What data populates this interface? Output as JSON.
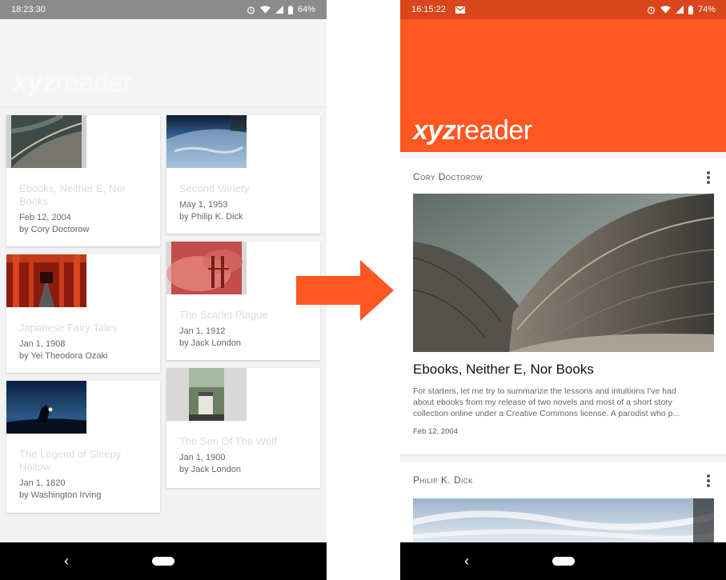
{
  "left": {
    "status": {
      "time": "18:23:30",
      "battery": "64%"
    },
    "app_logo": {
      "bold": "xyz",
      "rest": "reader"
    },
    "articles": [
      {
        "title": "Ebooks, Neither E, Nor Books",
        "date": "Feb 12, 2004",
        "author": "by Cory Doctorow",
        "image": "concrete-roof-photo"
      },
      {
        "title": "Second Variety",
        "date": "May 1, 1953",
        "author": "by Philip K. Dick",
        "image": "earth-from-space-photo"
      },
      {
        "title": "Japanese Fairy Tales",
        "date": "Jan 1, 1908",
        "author": "by Yei Theodora Ozaki",
        "image": "torii-gates-photo"
      },
      {
        "title": "The Scarlet Plague",
        "date": "Jan 1, 1912",
        "author": "by Jack London",
        "image": "bridge-in-red-fog-photo"
      },
      {
        "title": "The Legend of Sleepy Hollow",
        "date": "Jan 1, 1820",
        "author": "by Washington Irving",
        "image": "person-at-night-photo"
      },
      {
        "title": "The Son Of The Wolf",
        "date": "Jan 1, 1900",
        "author": "by Jack London",
        "image": "jar-on-table-photo"
      }
    ]
  },
  "right": {
    "status": {
      "time": "16:15:22",
      "battery": "74%"
    },
    "app_logo": {
      "bold": "xyz",
      "rest": "reader"
    },
    "featured": {
      "author": "Cory Doctorow",
      "title": "Ebooks, Neither E, Nor Books",
      "body_lines": [
        "For starters, let me try to summarize the lessons and intuitions I've had",
        "about ebooks from my release of two novels and most of a short story",
        "collection online under a Creative Commons license. A parodist who p..."
      ],
      "date": "Feb 12, 2004"
    },
    "second": {
      "author": "Philip K. Dick"
    }
  },
  "colors": {
    "accent": "#ff5722",
    "status_bar_accent": "#d9461c",
    "arrow": "#ff5722"
  },
  "icons": [
    "alarm-icon",
    "wifi-icon",
    "signal-icon",
    "battery-icon",
    "gmail-icon",
    "back-icon",
    "home-icon",
    "more-vert-icon"
  ]
}
